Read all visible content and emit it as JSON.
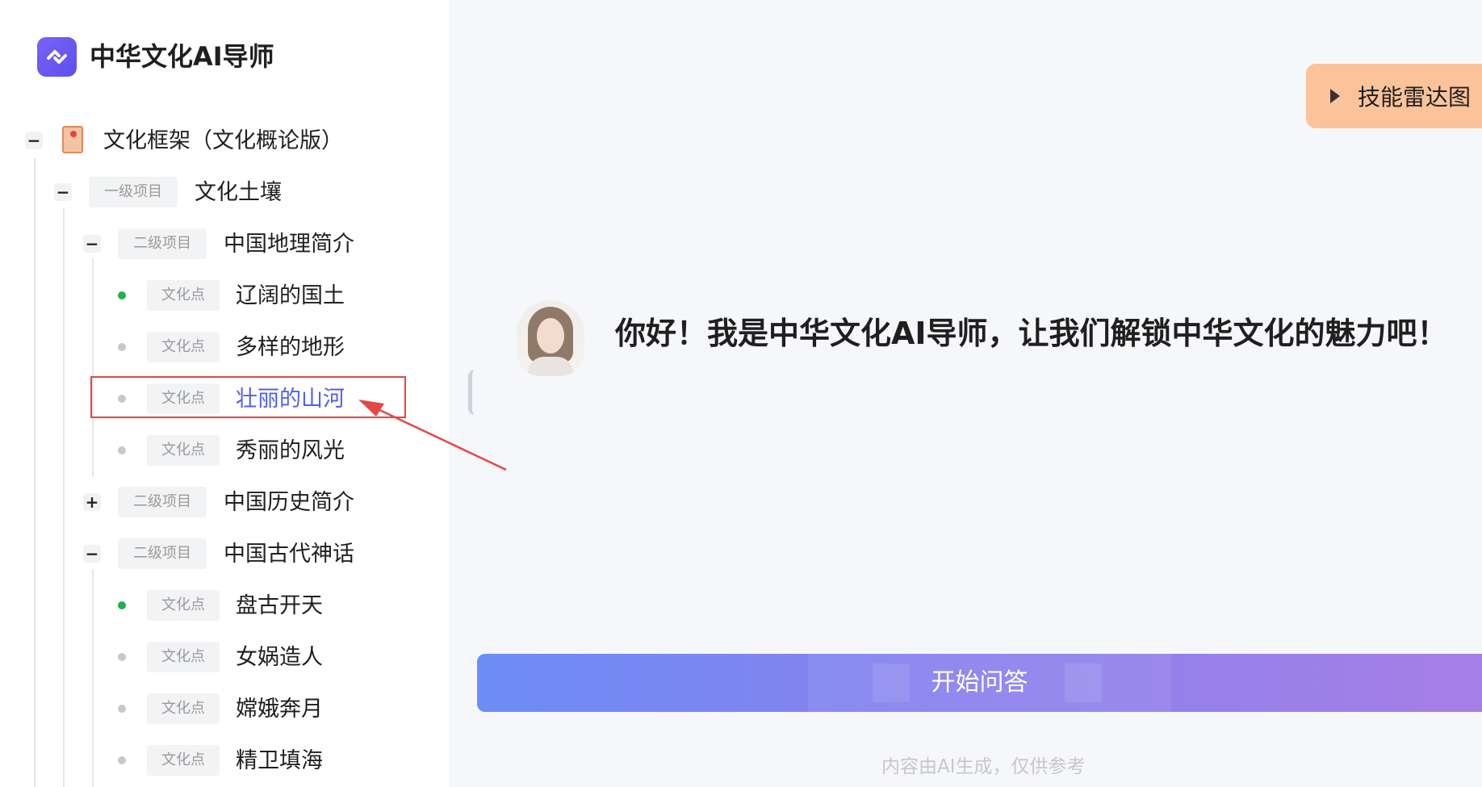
{
  "app": {
    "title": "中华文化AI导师",
    "brand_color": "#5a4ff0"
  },
  "tree": {
    "root": {
      "label": "文化框架（文化概论版）",
      "toggle": "−"
    },
    "level1": {
      "badge": "一级项目",
      "label": "文化土壤",
      "toggle": "−"
    },
    "geo": {
      "badge": "二级项目",
      "label": "中国地理简介",
      "toggle": "−",
      "items": [
        {
          "badge": "文化点",
          "label": "辽阔的国土",
          "status": "done"
        },
        {
          "badge": "文化点",
          "label": "多样的地形",
          "status": "pending"
        },
        {
          "badge": "文化点",
          "label": "壮丽的山河",
          "status": "pending",
          "selected": true
        },
        {
          "badge": "文化点",
          "label": "秀丽的风光",
          "status": "pending"
        }
      ]
    },
    "history": {
      "badge": "二级项目",
      "label": "中国历史简介",
      "toggle": "+"
    },
    "myth": {
      "badge": "二级项目",
      "label": "中国古代神话",
      "toggle": "−",
      "items": [
        {
          "badge": "文化点",
          "label": "盘古开天",
          "status": "done"
        },
        {
          "badge": "文化点",
          "label": "女娲造人",
          "status": "pending"
        },
        {
          "badge": "文化点",
          "label": "嫦娥奔月",
          "status": "pending"
        },
        {
          "badge": "文化点",
          "label": "精卫填海",
          "status": "pending"
        }
      ]
    }
  },
  "main": {
    "radar_button": "技能雷达图",
    "greeting": "你好！我是中华文化AI导师，让我们解锁中华文化的魅力吧！",
    "start_button": "开始问答",
    "footer_note": "内容由AI生成，仅供参考"
  },
  "colors": {
    "active_text": "#4f5ff0",
    "done_dot": "#22b14c",
    "pending_dot": "#c8c8c8",
    "highlight": "#e64646",
    "radar_bg": "#fbc39a"
  }
}
